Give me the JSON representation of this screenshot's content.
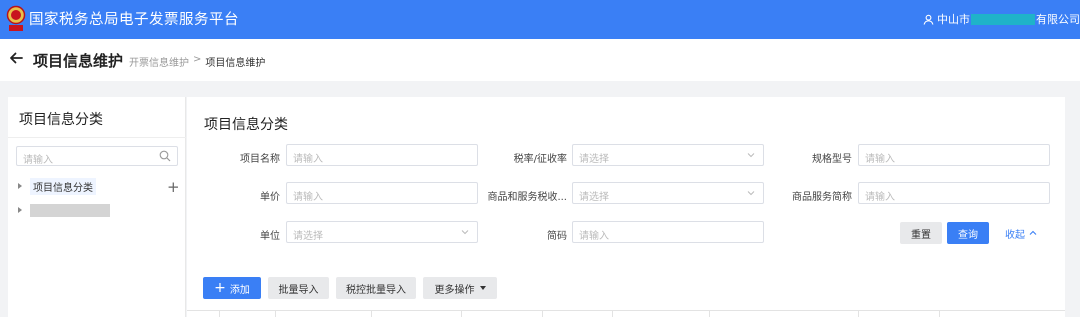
{
  "app": {
    "title": "国家税务总局电子发票服务平台",
    "user_prefix": "中山市",
    "user_suffix": "有限公司",
    "accent": "#3a7ff5"
  },
  "header": {
    "page_title": "项目信息维护",
    "breadcrumb": [
      "开票信息维护",
      ">",
      "项目信息维护"
    ]
  },
  "sidebar": {
    "title": "项目信息分类",
    "search_placeholder": "请输入",
    "tree": [
      {
        "label": "项目信息分类"
      },
      {
        "label": ""
      }
    ]
  },
  "main": {
    "title": "项目信息分类",
    "fields": {
      "item_name": {
        "label": "项目名称",
        "placeholder": "请输入"
      },
      "tax_rate": {
        "label": "税率/征收率",
        "placeholder": "请选择"
      },
      "spec_model": {
        "label": "规格型号",
        "placeholder": "请输入"
      },
      "unit_price": {
        "label": "单价",
        "placeholder": "请输入"
      },
      "goods_tax_code": {
        "label": "商品和服务税收...",
        "placeholder": "请选择"
      },
      "goods_short_name": {
        "label": "商品服务简称",
        "placeholder": "请输入"
      },
      "unit": {
        "label": "单位",
        "placeholder": "请选择"
      },
      "short_code": {
        "label": "简码",
        "placeholder": "请输入"
      }
    },
    "buttons": {
      "reset": "重置",
      "query": "查询",
      "collapse": "收起"
    },
    "toolbar": {
      "add": "添加",
      "batch_import": "批量导入",
      "tax_batch_import": "税控批量导入",
      "more_actions": "更多操作"
    }
  }
}
